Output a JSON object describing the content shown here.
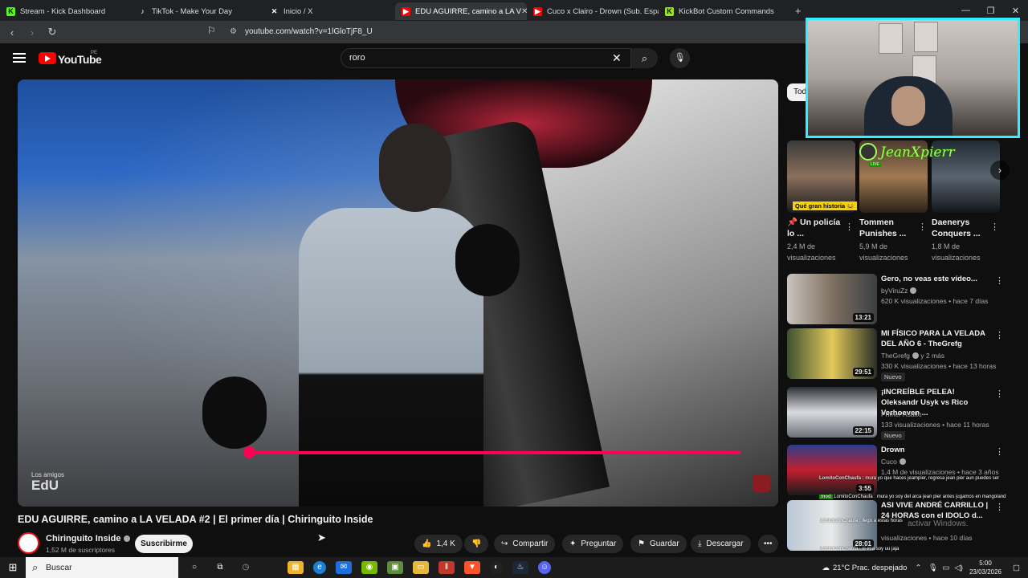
{
  "browser": {
    "tabs": [
      {
        "label": "Stream - Kick Dashboard",
        "icon": "kick-icon",
        "color": "#53fc18"
      },
      {
        "label": "TikTok - Make Your Day",
        "icon": "tiktok-icon",
        "color": "#ffffff"
      },
      {
        "label": "Inicio / X",
        "icon": "x-icon",
        "color": "#ffffff"
      },
      {
        "label": "EDU AGUIRRE, camino a LA V",
        "icon": "youtube-icon",
        "color": "#ff0000",
        "active": true
      },
      {
        "label": "Cuco x Clairo - Drown (Sub. Español",
        "icon": "youtube-icon",
        "color": "#ff0000"
      },
      {
        "label": "KickBot Custom Commands",
        "icon": "kickbot-icon",
        "color": "#9be31a"
      }
    ],
    "url": "youtube.com/watch?v=1lGloTjF8_U"
  },
  "youtube": {
    "logo_text": "YouTube",
    "country_code": "PE",
    "search_value": "roro",
    "video": {
      "watermark_line1": "Los amigos",
      "watermark_line2": "EdU",
      "progress_fraction": 0.3
    },
    "title": "EDU AGUIRRE, camino a LA VELADA #2 | El primer día | Chiringuito Inside",
    "channel": {
      "name": "Chiringuito Inside",
      "subscribers": "1,52 M de suscriptores"
    },
    "subscribe_label": "Suscribirme",
    "actions": {
      "likes": "1,4 K",
      "share": "Compartir",
      "ask": "Preguntar",
      "save": "Guardar",
      "download": "Descargar"
    },
    "chip_label": "Todo",
    "shorts": [
      {
        "title": "📌 Un policía lo ...",
        "views": "2,4 M de visualizaciones",
        "badge": "Qué gran historia 😂"
      },
      {
        "title": "Tommen Punishes ...",
        "views": "5,9 M de visualizaciones"
      },
      {
        "title": "Daenerys Conquers ...",
        "views": "1,8 M de visualizaciones"
      }
    ],
    "recommendations": [
      {
        "title": "Gero, no veas este vídeo...",
        "channel": "byViruZz",
        "meta": "620 K visualizaciones • hace 7 días",
        "duration": "13:21",
        "badge": ""
      },
      {
        "title": "MI FÍSICO PARA LA VELADA DEL AÑO 6 - TheGrefg",
        "channel": "TheGrefg",
        "channel_extra": "y 2 más",
        "meta": "330 K visualizaciones • hace 13 horas",
        "duration": "29:51",
        "badge": "Nuevo"
      },
      {
        "title": "¡INCREÍBLE PELEA! Oleksandr Usyk vs Rico Verhoeven ...",
        "channel": "Primer Asalto",
        "meta": "133 visualizaciones • hace 11 horas",
        "duration": "22:15",
        "badge": "Nuevo"
      },
      {
        "title": "Drown",
        "channel": "Cuco",
        "meta": "1,4 M de visualizaciones • hace 3 años",
        "duration": "3:55",
        "badge": ""
      },
      {
        "title": "ASI VIVE ANDRÉ CARRILLO | 24 HORAS con el IDOLO d...",
        "channel": "",
        "meta": "visualizaciones • hace 10 días",
        "duration": "28:01",
        "badge": ""
      }
    ]
  },
  "overlay": {
    "webcam_name": "JeanXpierr",
    "live_label": "LIVE",
    "chat": [
      {
        "user": "LomitoConChaufa :",
        "text": "mura yo que haces jeampier, regresa jean pier aun puedes ser"
      },
      {
        "user": "mod",
        "text": "LomitoConChaufa : mura yo soy del arca jean pier antes jugamos en mangoland"
      },
      {
        "user": "",
        "text": "LomitoConChaufa : llego a estas horas"
      },
      {
        "user": "",
        "text": "LomitoConChaufa : si esa soy uu jaja"
      }
    ],
    "activate_windows": "activar Windows."
  },
  "taskbar": {
    "search_placeholder": "Buscar",
    "weather": "21°C  Prac. despejado",
    "time": "5:00",
    "date": "23/03/2026"
  }
}
